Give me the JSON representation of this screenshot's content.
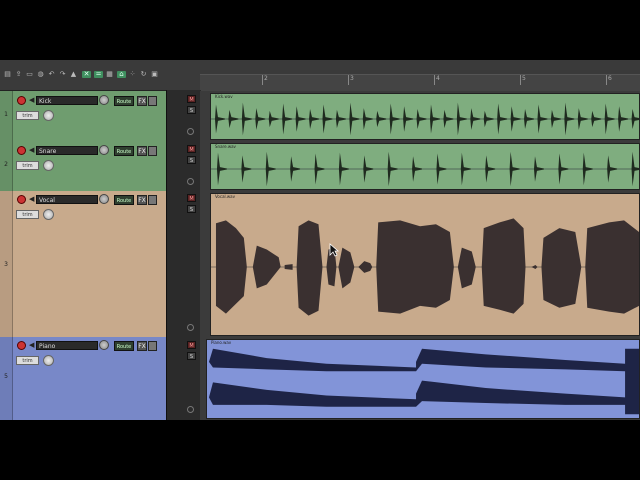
{
  "toolbar": {
    "icons": [
      "new-project-icon",
      "open-project-icon",
      "save-project-icon",
      "project-settings-icon",
      "undo-icon",
      "redo-icon",
      "metronome-icon",
      "grid-snap-icon",
      "ripple-edit-icon",
      "item-grouping-icon",
      "auto-crossfade-icon",
      "envelope-lock-icon",
      "loop-icon",
      "lock-icon"
    ]
  },
  "ruler": {
    "marks": [
      "2",
      "3",
      "4",
      "5",
      "6"
    ]
  },
  "tracks": [
    {
      "num": "1",
      "name": "Kick",
      "route": "Route",
      "fx": "FX",
      "trim": "trim",
      "mute": "M",
      "solo": "S",
      "item": "Kick.wav",
      "color": "#6f9d6f",
      "item_color": "#7fad7f"
    },
    {
      "num": "2",
      "name": "Snare",
      "route": "Route",
      "fx": "FX",
      "trim": "trim",
      "mute": "M",
      "solo": "S",
      "item": "Snare.wav",
      "color": "#6f9d6f",
      "item_color": "#7fad7f"
    },
    {
      "num": "3",
      "name": "Vocal",
      "route": "Route",
      "fx": "FX",
      "trim": "trim",
      "mute": "M",
      "solo": "S",
      "item": "Vocal.wav",
      "color": "#c8aa8c",
      "item_color": "#c8aa8c"
    },
    {
      "num": "5",
      "name": "Piano",
      "route": "Route",
      "fx": "FX",
      "trim": "trim",
      "mute": "M",
      "solo": "S",
      "item": "Piano.wav",
      "color": "#7888c8",
      "item_color": "#8294d8"
    }
  ]
}
